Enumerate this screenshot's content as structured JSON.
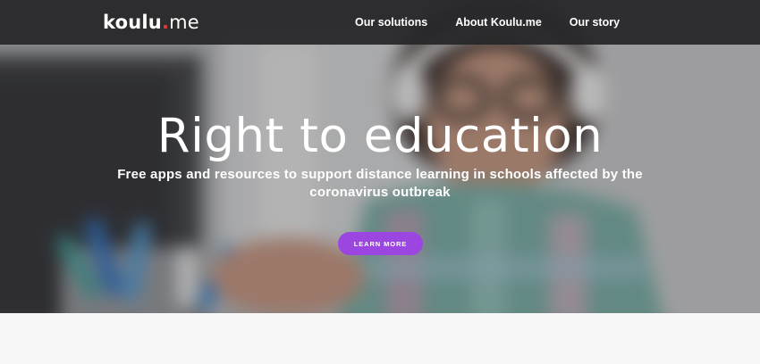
{
  "brand": {
    "name": "koulu",
    "dot": ".",
    "tld": "me"
  },
  "nav": {
    "items": [
      {
        "label": "Our solutions"
      },
      {
        "label": "About Koulu.me"
      },
      {
        "label": "Our story"
      }
    ]
  },
  "hero": {
    "title": "Right to education",
    "subtitle": "Free apps and resources to support distance learning in schools affected by the coronavirus outbreak",
    "cta_label": "LEARN MORE",
    "image": "blurred-photo-of-girl-with-glasses-and-headphones-at-desk"
  },
  "colors": {
    "navbar": "#262628",
    "cta": "#9b46e0",
    "logo_dot": "#e23a3a",
    "page_background": "#f7f7f7"
  }
}
